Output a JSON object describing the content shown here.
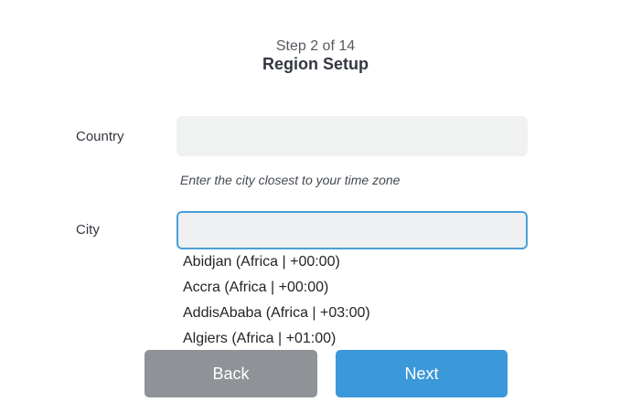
{
  "header": {
    "step": "Step 2 of 14",
    "title": "Region Setup"
  },
  "form": {
    "country_label": "Country",
    "country_value": "",
    "hint": "Enter the city closest to your time zone",
    "city_label": "City",
    "city_value": ""
  },
  "city_options": [
    "Abidjan (Africa | +00:00)",
    "Accra (Africa | +00:00)",
    "AddisAbaba (Africa | +03:00)",
    "Algiers (Africa | +01:00)"
  ],
  "buttons": {
    "back": "Back",
    "next": "Next"
  },
  "colors": {
    "accent": "#3b98d9",
    "back_button": "#8f9296",
    "field_focus_border": "#4aa0d8"
  }
}
